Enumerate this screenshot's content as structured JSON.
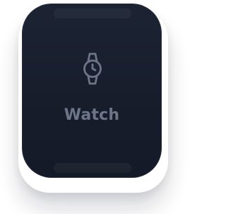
{
  "tile": {
    "label": "Watch",
    "icon": "watch-icon"
  },
  "colors": {
    "card_background": "#1a2030",
    "icon_and_text": "#6d7688"
  }
}
